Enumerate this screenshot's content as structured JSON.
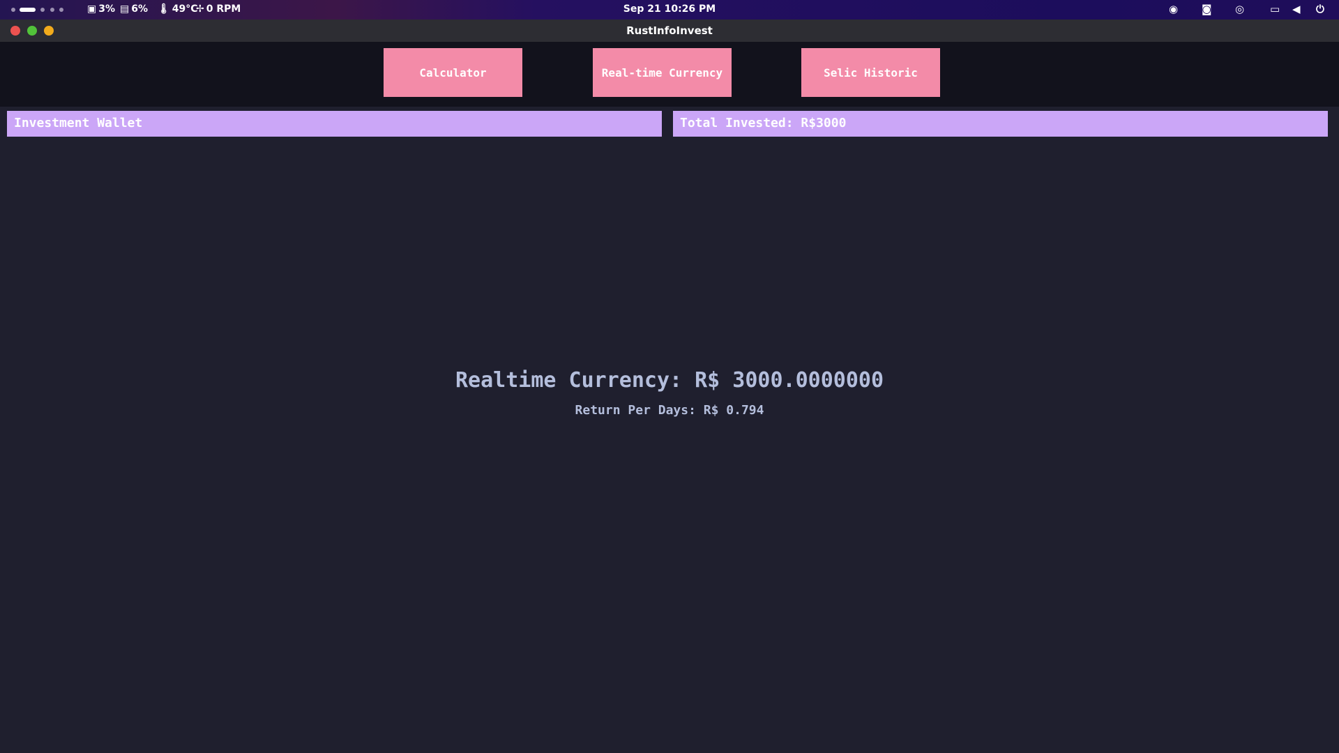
{
  "system_bar": {
    "cpu": "3%",
    "gpu": "6%",
    "temperature": "49°C",
    "fan": "0 RPM",
    "clock": "Sep 21  10:26 PM",
    "tray_icons": [
      "steam-icon",
      "discord-icon",
      "spotify-icon",
      "network-icon",
      "volume-icon",
      "power-icon"
    ]
  },
  "window": {
    "title": "RustInfoInvest"
  },
  "nav": {
    "buttons": [
      "Calculator",
      "Real-time Currency",
      "Selic Historic"
    ]
  },
  "panels": {
    "wallet": "Investment Wallet",
    "total": "Total Invested: R$3000"
  },
  "main": {
    "realtime": "Realtime Currency: R$ 3000.0000000",
    "return": "Return Per Days: R$ 0.794"
  },
  "colors": {
    "button": "#f38ba8",
    "panel": "#cba6f7",
    "background": "#1f1f2e",
    "text": "#b4bedc"
  }
}
